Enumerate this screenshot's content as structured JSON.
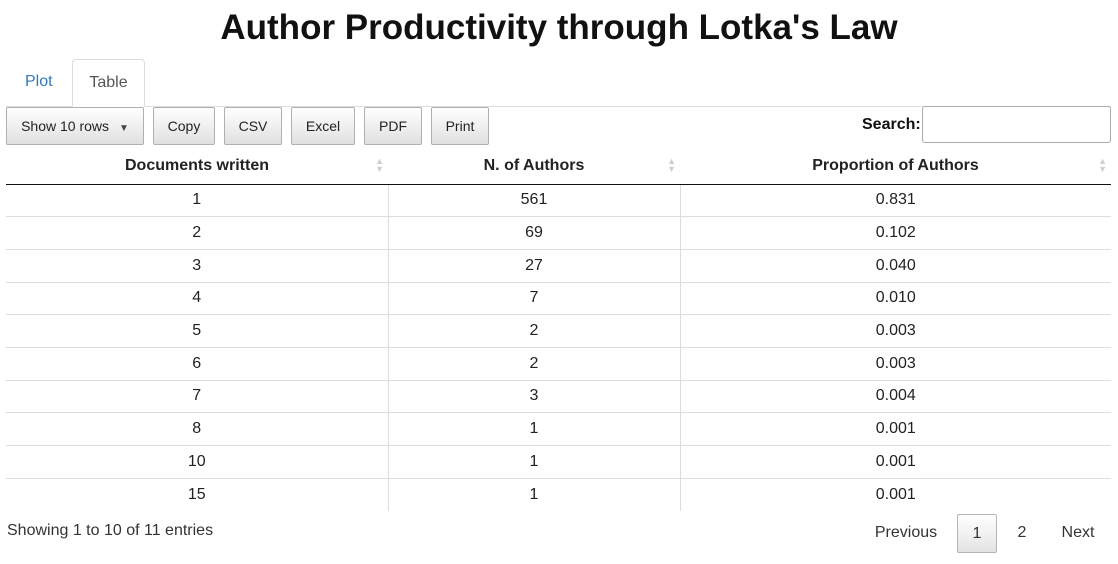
{
  "title": "Author Productivity through Lotka's Law",
  "tabs": [
    {
      "label": "Plot"
    },
    {
      "label": "Table"
    }
  ],
  "toolbar": {
    "show_rows_label": "Show 10 rows",
    "caret": "▼",
    "copy_label": "Copy",
    "csv_label": "CSV",
    "excel_label": "Excel",
    "pdf_label": "PDF",
    "print_label": "Print",
    "search_label": "Search:",
    "search_value": ""
  },
  "table": {
    "columns": [
      "Documents written",
      "N. of Authors",
      "Proportion of Authors"
    ],
    "rows": [
      [
        "1",
        "561",
        "0.831"
      ],
      [
        "2",
        "69",
        "0.102"
      ],
      [
        "3",
        "27",
        "0.040"
      ],
      [
        "4",
        "7",
        "0.010"
      ],
      [
        "5",
        "2",
        "0.003"
      ],
      [
        "6",
        "2",
        "0.003"
      ],
      [
        "7",
        "3",
        "0.004"
      ],
      [
        "8",
        "1",
        "0.001"
      ],
      [
        "10",
        "1",
        "0.001"
      ],
      [
        "15",
        "1",
        "0.001"
      ]
    ]
  },
  "footer": {
    "info": "Showing 1 to 10 of 11 entries",
    "previous": "Previous",
    "pages": [
      "1",
      "2"
    ],
    "next": "Next"
  },
  "colors": {
    "tab_link": "#337ab7",
    "header_border": "#111111",
    "row_border": "#dddddd"
  }
}
